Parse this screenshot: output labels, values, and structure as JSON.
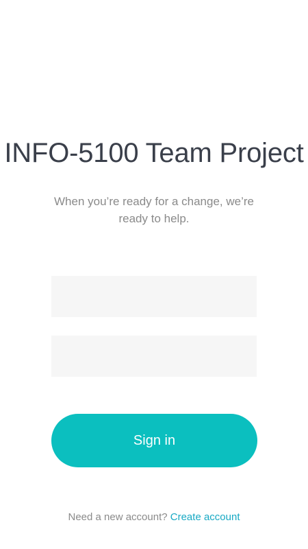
{
  "login": {
    "title": "INFO-5100 Team Project",
    "subtitle": "When you’re ready for a change, we’re ready to help.",
    "email_value": "",
    "password_value": "",
    "signin_label": "Sign in",
    "footer_prompt": "Need a new account?",
    "create_account_label": "Create account"
  },
  "colors": {
    "accent": "#0bbfbf",
    "link": "#17a9c4",
    "title_text": "#3a3f4a",
    "muted_text": "#8a8a8a",
    "field_background": "#f6f6f6"
  }
}
